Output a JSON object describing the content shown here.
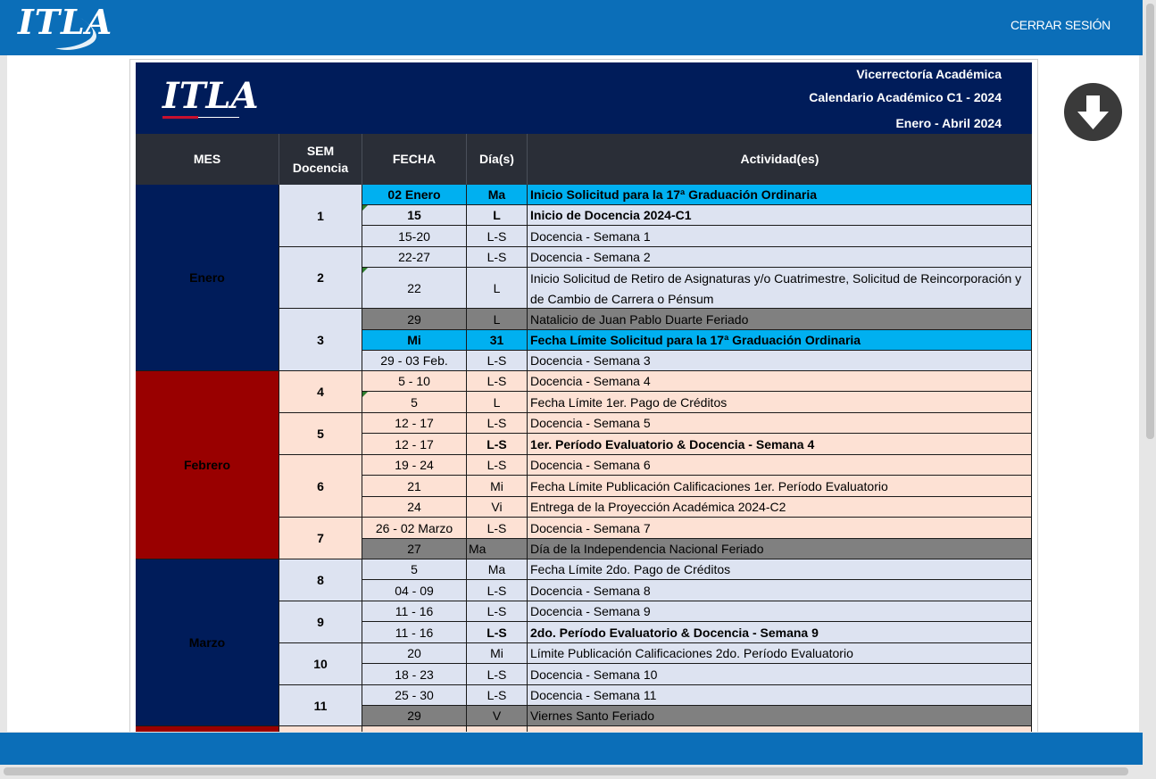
{
  "app": {
    "brand": "ITLA",
    "logout_label": "CERRAR SESIÓN"
  },
  "calendar": {
    "logo": "ITLA",
    "header_lines": [
      "Vicerrectoría Académica",
      "Calendario Académico C1 - 2024",
      "Enero - Abril 2024"
    ],
    "columns": [
      "MES",
      "SEM\nDocencia",
      "FECHA",
      "Día(s)",
      "Actividad(es)"
    ],
    "colors": {
      "header_navy": "#001c5a",
      "table_header": "#2a2e37",
      "enero_band": "#001c5a",
      "febrero_band": "#990000",
      "enero_row": "#dde3f1",
      "febrero_row": "#fde1d4",
      "highlight_blue": "#00b0f0",
      "holiday_gray": "#808080"
    },
    "months": [
      {
        "name": "Enero",
        "theme": "blue"
      },
      {
        "name": "Febrero",
        "theme": "red"
      },
      {
        "name": "Marzo",
        "theme": "blue"
      },
      {
        "name": "",
        "theme": "red"
      }
    ],
    "weeks": [
      "1",
      "2",
      "3",
      "4",
      "5",
      "6",
      "7",
      "8",
      "9",
      "10",
      "11",
      ""
    ],
    "rows": [
      {
        "date": "02 Enero",
        "day": "Ma",
        "activity": "Inicio Solicitud para la 17ª Graduación Ordinaria",
        "style": "blue",
        "bold": true
      },
      {
        "date": "15",
        "day": "L",
        "activity": "Inicio de Docencia 2024-C1",
        "style": "normal",
        "bold": true
      },
      {
        "date": "15-20",
        "day": "L-S",
        "activity": "Docencia - Semana 1",
        "style": "normal",
        "bold": false
      },
      {
        "date": "22-27",
        "day": "L-S",
        "activity": "Docencia - Semana 2",
        "style": "normal",
        "bold": false
      },
      {
        "date": "22",
        "day": "L",
        "activity": "Inicio Solicitud de Retiro de Asignaturas y/o Cuatrimestre, Solicitud de Reincorporación y de Cambio de Carrera o Pénsum",
        "style": "normal",
        "bold": false
      },
      {
        "date": "29",
        "day": "L",
        "activity": "Natalicio de Juan Pablo Duarte Feriado",
        "style": "gray",
        "bold": false
      },
      {
        "date": "Mi",
        "day": "31",
        "activity": "Fecha Límite Solicitud para la 17ª Graduación Ordinaria",
        "style": "blue",
        "bold": true
      },
      {
        "date": "29 - 03 Feb.",
        "day": "L-S",
        "activity": "Docencia - Semana 3",
        "style": "normal",
        "bold": false
      },
      {
        "date": "5 - 10",
        "day": "L-S",
        "activity": "Docencia - Semana 4",
        "style": "normal",
        "bold": false
      },
      {
        "date": "5",
        "day": "L",
        "activity": "Fecha Límite 1er. Pago de Créditos",
        "style": "normal",
        "bold": false
      },
      {
        "date": "12 - 17",
        "day": "L-S",
        "activity": "Docencia - Semana 5",
        "style": "normal",
        "bold": false
      },
      {
        "date": "12 - 17",
        "day": "L-S",
        "activity": "1er. Período Evaluatorio  & Docencia - Semana 4",
        "style": "normal",
        "bold": true
      },
      {
        "date": "19 - 24",
        "day": "L-S",
        "activity": "Docencia - Semana 6",
        "style": "normal",
        "bold": false
      },
      {
        "date": "21",
        "day": "Mi",
        "activity": "Fecha Límite Publicación Calificaciones 1er. Período Evaluatorio",
        "style": "normal",
        "bold": false
      },
      {
        "date": "24",
        "day": "Vi",
        "activity": "Entrega de la Proyección Académica 2024-C2",
        "style": "normal",
        "bold": false
      },
      {
        "date": "26 - 02 Marzo",
        "day": "L-S",
        "activity": "Docencia - Semana 7",
        "style": "normal",
        "bold": false
      },
      {
        "date": "27",
        "day": "Ma",
        "activity": "Día de la Independencia Nacional Feriado",
        "style": "gray",
        "bold": false
      },
      {
        "date": "5",
        "day": "Ma",
        "activity": "Fecha Límite 2do. Pago de Créditos",
        "style": "normal",
        "bold": false
      },
      {
        "date": "04 - 09",
        "day": "L-S",
        "activity": "Docencia - Semana 8",
        "style": "normal",
        "bold": false
      },
      {
        "date": "11 - 16",
        "day": "L-S",
        "activity": "Docencia - Semana 9",
        "style": "normal",
        "bold": false
      },
      {
        "date": "11 - 16",
        "day": "L-S",
        "activity": "2do. Período Evaluatorio & Docencia - Semana 9",
        "style": "normal",
        "bold": true
      },
      {
        "date": "20",
        "day": "Mi",
        "activity": "Límite Publicación Calificaciones 2do. Período Evaluatorio",
        "style": "normal",
        "bold": false
      },
      {
        "date": "18 - 23",
        "day": "L-S",
        "activity": "Docencia -  Semana 10",
        "style": "normal",
        "bold": false
      },
      {
        "date": "25 - 30",
        "day": "L-S",
        "activity": "Docencia -  Semana 11",
        "style": "normal",
        "bold": false
      },
      {
        "date": "29",
        "day": "V",
        "activity": "Viernes Santo Feriado",
        "style": "gray",
        "bold": false
      },
      {
        "date": "",
        "day": "",
        "activity": "",
        "style": "normal",
        "bold": false
      }
    ]
  },
  "download": {
    "icon": "download-arrow-icon"
  }
}
